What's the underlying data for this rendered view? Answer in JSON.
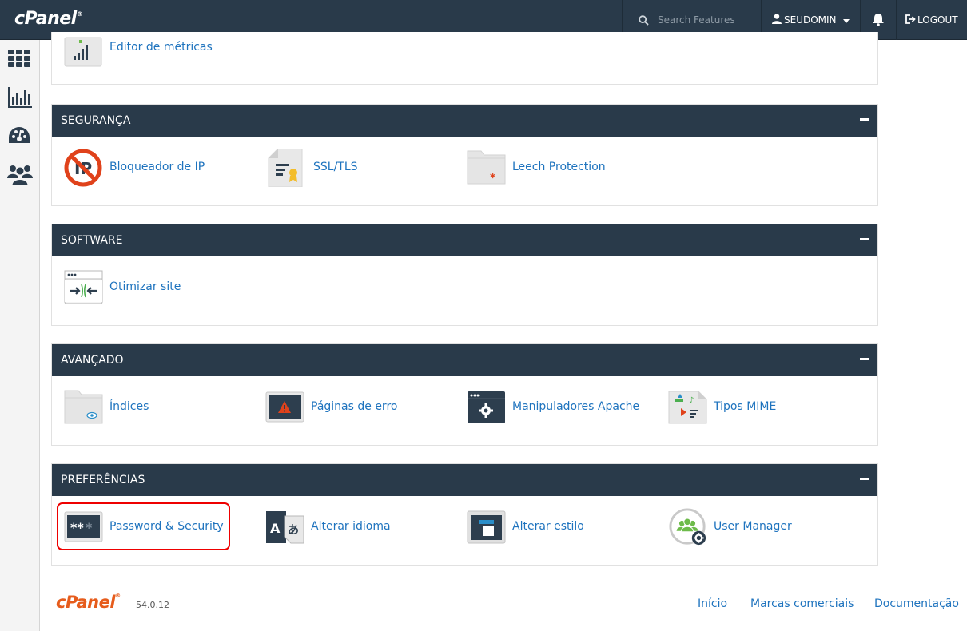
{
  "header": {
    "brand": "cPanel",
    "search_placeholder": "Search Features",
    "username": "SEUDOMIN",
    "logout_label": "LOGOUT"
  },
  "sidebar": {
    "icons": [
      "apps-grid-icon",
      "stats-chart-icon",
      "dashboard-gauge-icon",
      "users-icon"
    ]
  },
  "top_partial": {
    "item_label": "Editor de métricas"
  },
  "sections": [
    {
      "title": "SEGURANÇA",
      "items": [
        {
          "label": "Bloqueador de IP",
          "icon": "ip-blocker-icon"
        },
        {
          "label": "SSL/TLS",
          "icon": "ssl-certificate-icon"
        },
        {
          "label": "Leech Protection",
          "icon": "leech-protection-folder-icon"
        }
      ]
    },
    {
      "title": "SOFTWARE",
      "items": [
        {
          "label": "Otimizar site",
          "icon": "optimize-site-icon"
        }
      ]
    },
    {
      "title": "AVANÇADO",
      "items": [
        {
          "label": "Índices",
          "icon": "indexes-folder-icon"
        },
        {
          "label": "Páginas de erro",
          "icon": "error-pages-icon"
        },
        {
          "label": "Manipuladores Apache",
          "icon": "apache-handlers-icon"
        },
        {
          "label": "Tipos MIME",
          "icon": "mime-types-icon"
        }
      ]
    },
    {
      "title": "PREFERÊNCIAS",
      "items": [
        {
          "label": "Password & Security",
          "icon": "password-security-icon"
        },
        {
          "label": "Alterar idioma",
          "icon": "change-language-icon"
        },
        {
          "label": "Alterar estilo",
          "icon": "change-style-icon"
        },
        {
          "label": "User Manager",
          "icon": "user-manager-icon"
        }
      ]
    }
  ],
  "footer": {
    "brand": "cPanel",
    "version": "54.0.12",
    "links": [
      "Início",
      "Marcas comerciais",
      "Documentação"
    ]
  },
  "colors": {
    "header_bg": "#293a4a",
    "link": "#1e73be",
    "footer_brand": "#e65c1c",
    "highlight": "#ee0000"
  }
}
